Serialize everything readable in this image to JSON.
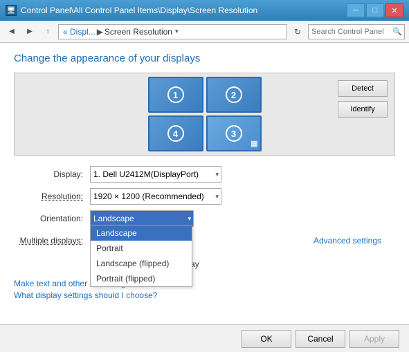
{
  "titleBar": {
    "icon": "🖥",
    "text": "Control Panel\\All Control Panel Items\\Display\\Screen Resolution",
    "minBtn": "─",
    "maxBtn": "□",
    "closeBtn": "✕"
  },
  "addressBar": {
    "backBtn": "◀",
    "forwardBtn": "▶",
    "upBtn": "↑",
    "breadcrumb": {
      "parent": "« Displ...",
      "separator": "▶",
      "current": "Screen Resolution"
    },
    "dropdownBtn": "▾",
    "refreshBtn": "↻",
    "searchPlaceholder": "Search Control Panel",
    "searchIcon": "🔍"
  },
  "main": {
    "pageTitle": "Change the appearance of your displays",
    "monitors": [
      {
        "num": "①",
        "id": "1"
      },
      {
        "num": "②",
        "id": "2"
      },
      {
        "num": "④",
        "id": "4"
      },
      {
        "num": "③",
        "id": "3"
      }
    ],
    "detectBtn": "Detect",
    "identifyBtn": "Identify",
    "form": {
      "displayLabel": "Display:",
      "displayValue": "1. Dell U2412M(DisplayPort)",
      "resolutionLabel": "Resolution:",
      "resolutionValue": "1920 × 1200 (Recommended)",
      "orientationLabel": "Orientation:",
      "orientationValue": "Landscape",
      "multipleDisplaysLabel": "Multiple displays:",
      "multipleDisplaysValue": "display",
      "checkboxLabel": "Make this my main display"
    },
    "orientationDropdown": {
      "items": [
        {
          "label": "Landscape",
          "selected": true
        },
        {
          "label": "Portrait",
          "selected": false
        },
        {
          "label": "Landscape (flipped)",
          "selected": false
        },
        {
          "label": "Portrait (flipped)",
          "selected": false
        }
      ]
    },
    "advancedLink": "Advanced settings",
    "links": [
      "Make text and other items larger or smaller",
      "What display settings should I choose?"
    ]
  },
  "bottomBar": {
    "okBtn": "OK",
    "cancelBtn": "Cancel",
    "applyBtn": "Apply"
  }
}
